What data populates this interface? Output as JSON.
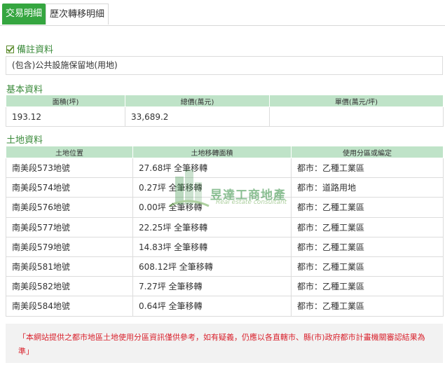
{
  "tabs": [
    {
      "label": "交易明細",
      "active": true
    },
    {
      "label": "歷次轉移明細",
      "active": false
    }
  ],
  "remarks": {
    "title": "備註資料",
    "text": "(包含)公共設施保留地(用地)"
  },
  "basic": {
    "title": "基本資料",
    "headers": [
      "面積(坪)",
      "總價(萬元)",
      "單價(萬元/坪)"
    ],
    "row": [
      "193.12",
      "33,689.2",
      ""
    ]
  },
  "land": {
    "title": "土地資料",
    "headers": [
      "土地位置",
      "土地移轉面積",
      "使用分區或編定"
    ],
    "rows": [
      [
        "南美段573地號",
        "27.68坪 全筆移轉",
        "都市：乙種工業區"
      ],
      [
        "南美段574地號",
        "0.27坪 全筆移轉",
        "都市：道路用地"
      ],
      [
        "南美段576地號",
        "0.00坪 全筆移轉",
        "都市：乙種工業區"
      ],
      [
        "南美段577地號",
        "22.25坪 全筆移轉",
        "都市：乙種工業區"
      ],
      [
        "南美段579地號",
        "14.83坪 全筆移轉",
        "都市：乙種工業區"
      ],
      [
        "南美段581地號",
        "608.12坪 全筆移轉",
        "都市：乙種工業區"
      ],
      [
        "南美段582地號",
        "7.27坪 全筆移轉",
        "都市：乙種工業區"
      ],
      [
        "南美段584地號",
        "0.64坪 全筆移轉",
        "都市：乙種工業區"
      ]
    ]
  },
  "watermark": {
    "title": "昱達工商地產",
    "subtitle": "Real estate consultant"
  },
  "disclaimer": "「本網站提供之都市地區土地使用分區資訊僅供參考，如有疑義，仍應以各直轄市、縣(市)政府都市計畫機關審認結果為準」",
  "colors": {
    "accent": "#35a640",
    "header_bg": "#bfe3c8",
    "section_title": "#3a8a3a",
    "disclaimer_text": "#d9232e"
  }
}
